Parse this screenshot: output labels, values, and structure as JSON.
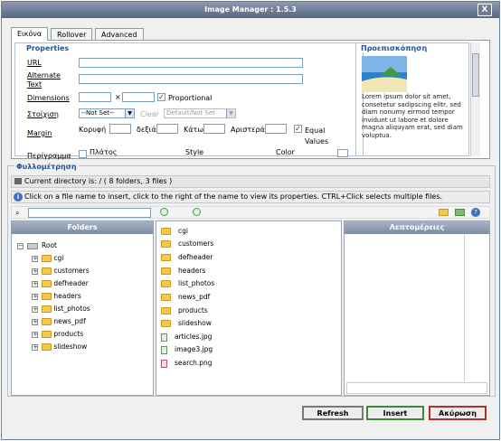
{
  "window": {
    "title": "Image Manager : 1.5.3",
    "close": "X"
  },
  "tabs": [
    {
      "label": "Εικόνα"
    },
    {
      "label": "Rollover"
    },
    {
      "label": "Advanced"
    }
  ],
  "properties": {
    "legend": "Properties",
    "url_label": "URL",
    "alt_label": "Alternate Text",
    "dimensions_label": "Dimensions",
    "times": "×",
    "proportional_label": "Proportional",
    "align_label": "Στοίχιση",
    "align_value": "--Not Set--",
    "clear_label": "Clear",
    "clear_value": "Default/Not Set",
    "margin_label": "Margin",
    "top_label": "Κορυφή",
    "right_label": "δεξιά",
    "bottom_label": "Κάτω",
    "left_label": "Αριστερά",
    "equal_label": "Equal Values",
    "border_label": "Περίγραμμα",
    "width_label": "Πλάτος",
    "style_label": "Style",
    "color_label": "Color"
  },
  "preview": {
    "legend": "Προεπισκόπηση",
    "text": "Lorem ipsum dolor sit amet, consetetur sadipscing elitr, sed diam nonumy eirmod tempor invidunt ut labore et dolore magna aliquyam erat, sed diam voluptua."
  },
  "browser": {
    "legend": "Φυλλομέτρηση",
    "current_dir": "Current directory is: / ( 8 folders, 3 files )",
    "hint": "Click on a file name to insert, click to the right of the name to view its properties. CTRL+Click selects multiple files.",
    "search_value": ""
  },
  "folders_header": "Folders",
  "details_header": "Λεπτομέρειες",
  "tree": {
    "root": "Root",
    "items": [
      "cgi",
      "customers",
      "defheader",
      "headers",
      "list_photos",
      "news_pdf",
      "products",
      "slideshow"
    ]
  },
  "files": {
    "folders": [
      "cgi",
      "customers",
      "defheader",
      "headers",
      "list_photos",
      "news_pdf",
      "products",
      "slideshow"
    ],
    "files": [
      "articles.jpg",
      "image3.jpg",
      "search.png"
    ]
  },
  "buttons": {
    "refresh": "Refresh",
    "insert": "Insert",
    "cancel": "Ακύρωση"
  },
  "colors": {
    "title": "#6b7892",
    "accent": "#22539c",
    "insert_border": "#3a8a3a",
    "cancel_border": "#b03030"
  }
}
